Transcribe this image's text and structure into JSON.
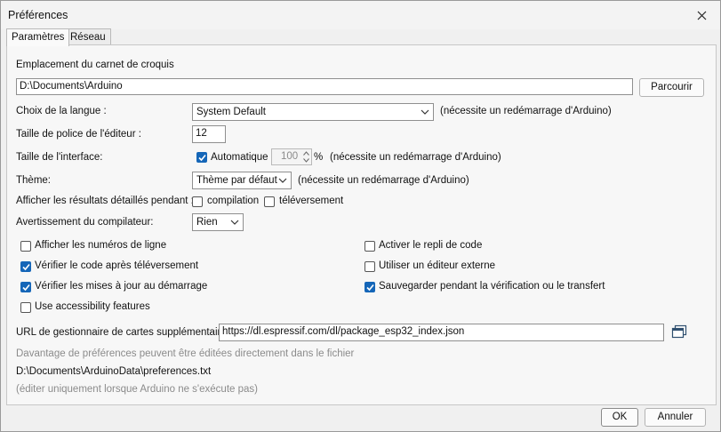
{
  "window": {
    "title": "Préférences"
  },
  "tabs": [
    {
      "label": "Paramètres"
    },
    {
      "label": "Réseau"
    }
  ],
  "sketchbook": {
    "label": "Emplacement du carnet de croquis",
    "path": "D:\\Documents\\Arduino",
    "browse": "Parcourir"
  },
  "language": {
    "label": "Choix de la langue :",
    "value": "System Default",
    "note": "(nécessite un redémarrage d'Arduino)"
  },
  "font_size": {
    "label": "Taille de police de l'éditeur :",
    "value": "12"
  },
  "interface_scale": {
    "label": "Taille de l'interface:",
    "auto_label": "Automatique",
    "auto_checked": true,
    "value": "100",
    "unit": "%",
    "note": "(nécessite un redémarrage d'Arduino)"
  },
  "theme": {
    "label": "Thème:",
    "value": "Thème par défaut",
    "note": "(nécessite un redémarrage d'Arduino)"
  },
  "verbose": {
    "label": "Afficher les résultats détaillés pendant :",
    "compile_label": "compilation",
    "compile_checked": false,
    "upload_label": "téléversement",
    "upload_checked": false
  },
  "warnings": {
    "label": "Avertissement du compilateur:",
    "value": "Rien"
  },
  "options_left": [
    {
      "label": "Afficher les numéros de ligne",
      "checked": false
    },
    {
      "label": "Vérifier le code après téléversement",
      "checked": true
    },
    {
      "label": "Vérifier les mises à jour au démarrage",
      "checked": true
    },
    {
      "label": "Use accessibility features",
      "checked": false
    }
  ],
  "options_right": [
    {
      "label": "Activer le repli de code",
      "checked": false
    },
    {
      "label": "Utiliser un éditeur externe",
      "checked": false
    },
    {
      "label": "Sauvegarder pendant la vérification ou le transfert",
      "checked": true
    }
  ],
  "boards_url": {
    "label": "URL de gestionnaire de cartes supplémentaires",
    "value": "https://dl.espressif.com/dl/package_esp32_index.json"
  },
  "footer_notes": {
    "more_prefs": "Davantage de préférences peuvent être éditées directement dans le fichier",
    "prefs_path": "D:\\Documents\\ArduinoData\\preferences.txt",
    "edit_hint": "(éditer uniquement lorsque Arduino ne s'exécute pas)"
  },
  "buttons": {
    "ok": "OK",
    "cancel": "Annuler"
  },
  "colors": {
    "accent": "#1566b8",
    "window_bg": "#f0f0f0",
    "panel_bg": "#f7f7f7"
  }
}
